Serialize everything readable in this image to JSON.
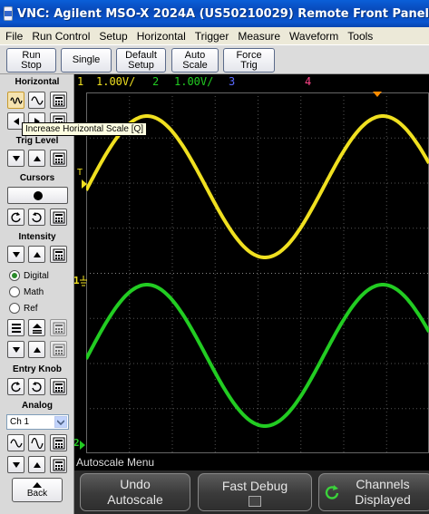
{
  "window": {
    "title": "VNC: Agilent MSO-X 2024A (US50210029) Remote Front Panel"
  },
  "menu": {
    "items": [
      "File",
      "Run Control",
      "Setup",
      "Horizontal",
      "Trigger",
      "Measure",
      "Waveform",
      "Tools"
    ]
  },
  "toolbar": {
    "run_stop": "Run\nStop",
    "single": "Single",
    "default_setup": "Default\nSetup",
    "auto_scale": "Auto\nScale",
    "force_trig": "Force\nTrig"
  },
  "left_panel": {
    "horizontal": "Horizontal",
    "trig_level": "Trig Level",
    "cursors": "Cursors",
    "intensity": "Intensity",
    "radio_digital": "Digital",
    "radio_math": "Math",
    "radio_ref": "Ref",
    "entry_knob": "Entry Knob",
    "analog": "Analog",
    "analog_select": "Ch 1",
    "back": "Back"
  },
  "tooltip": "Increase Horizontal Scale [Q]",
  "screen": {
    "ch1_num": "1",
    "ch1_scale": "1.00V/",
    "ch2_num": "2",
    "ch2_scale": "1.00V/",
    "ch3_num": "3",
    "ch4_num": "4",
    "trig_marker": "T",
    "ch1_marker": "1",
    "ch2_marker": "2",
    "ch1_color": "#f0e020",
    "ch2_color": "#22cc22",
    "ch3_color": "#5a6aff",
    "ch4_color": "#ff4488",
    "trigger_color": "#ff8c00"
  },
  "softkeys": {
    "menu_title": "Autoscale Menu",
    "undo_line1": "Undo",
    "undo_line2": "Autoscale",
    "fast_debug": "Fast Debug",
    "channels_line1": "Channels",
    "channels_line2": "Displayed"
  }
}
